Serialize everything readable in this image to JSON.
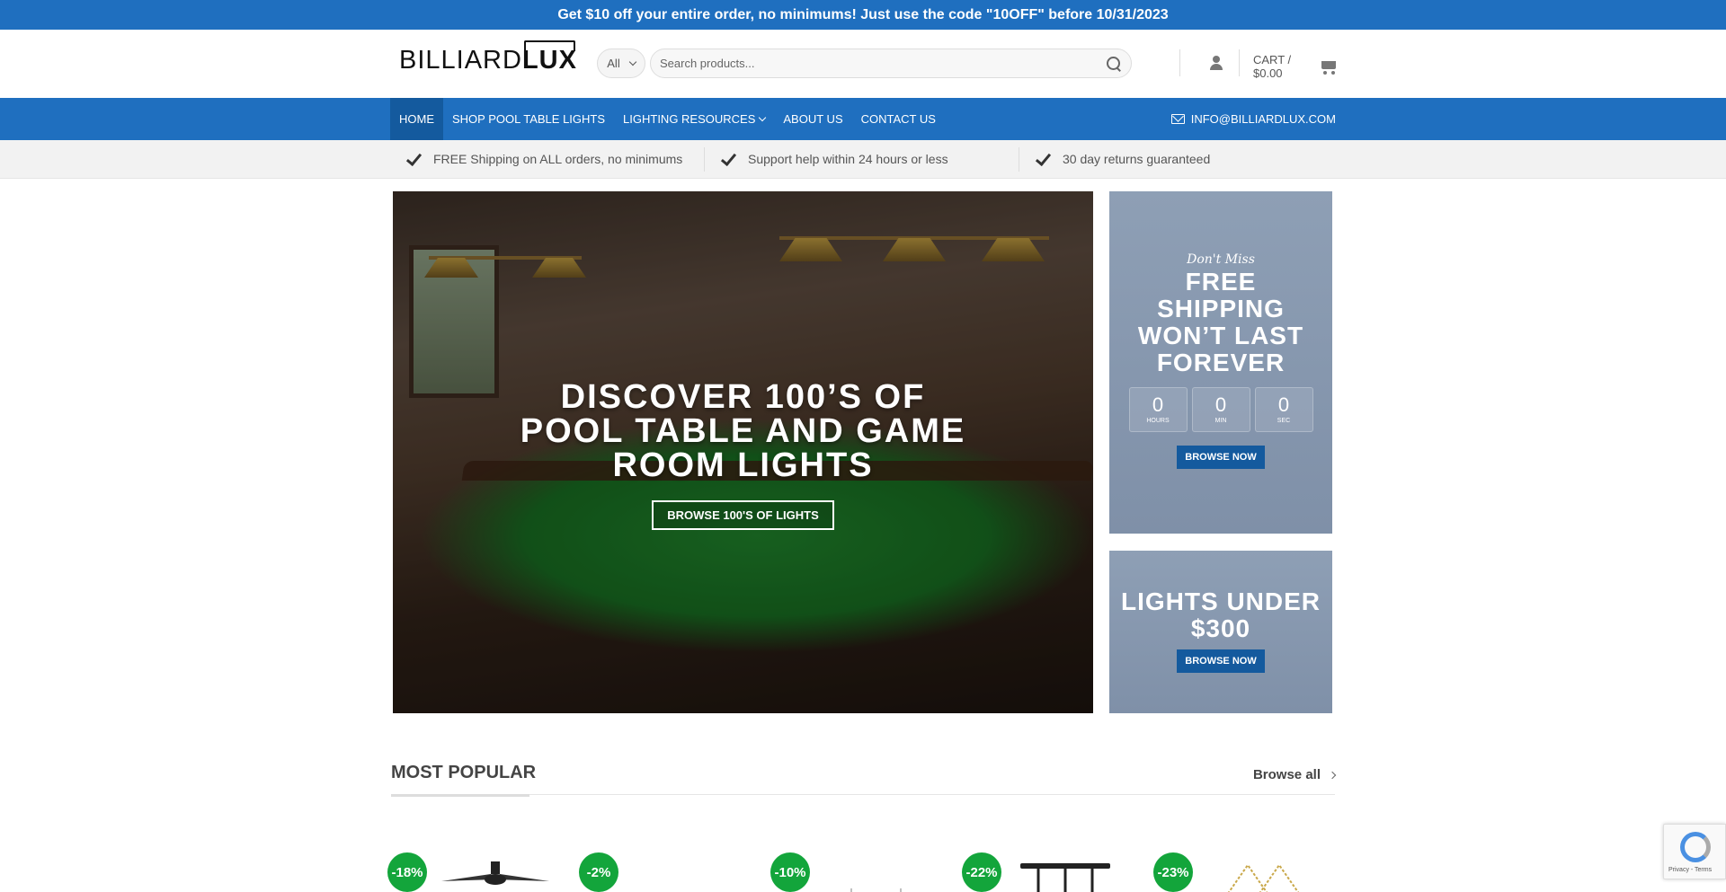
{
  "promo": {
    "text": "Get $10 off your entire order, no minimums! Just use the code \"10OFF\" before 10/31/2023"
  },
  "header": {
    "logo_part1": "BILLIARD",
    "logo_part2": "LUX",
    "category_selected": "All",
    "search_placeholder": "Search products...",
    "cart_label": "CART / $0.00"
  },
  "nav": {
    "items": [
      {
        "label": "HOME",
        "active": true
      },
      {
        "label": "SHOP POOL TABLE LIGHTS"
      },
      {
        "label": "LIGHTING RESOURCES",
        "dropdown": true
      },
      {
        "label": "ABOUT US"
      },
      {
        "label": "CONTACT US"
      }
    ],
    "email": "INFO@BILLIARDLUX.COM"
  },
  "usp": [
    "FREE Shipping on ALL orders, no minimums",
    "Support help within 24 hours or less",
    "30 day returns guaranteed"
  ],
  "hero": {
    "title": "DISCOVER 100’S OF POOL TABLE AND GAME ROOM LIGHTS",
    "button": "BROWSE 100'S OF LIGHTS"
  },
  "promo_box1": {
    "script": "Don't Miss",
    "title": "FREE SHIPPING WON’T LAST FOREVER",
    "countdown": [
      {
        "value": "0",
        "label": "HOURS"
      },
      {
        "value": "0",
        "label": "MIN"
      },
      {
        "value": "0",
        "label": "SEC"
      }
    ],
    "button": "BROWSE NOW"
  },
  "promo_box2": {
    "title": "LIGHTS UNDER $300",
    "button": "BROWSE NOW"
  },
  "section": {
    "title": "MOST POPULAR",
    "browse_all": "Browse all"
  },
  "products": [
    {
      "badge": "-18%"
    },
    {
      "badge": "-2%"
    },
    {
      "badge": "-10%"
    },
    {
      "badge": "-22%"
    },
    {
      "badge": "-23%"
    }
  ],
  "colors": {
    "brand_blue": "#1f6fbf",
    "nav_active": "#145a9e",
    "badge_green": "#13a53b",
    "promo_box": "#8e9fb5"
  },
  "recaptcha": {
    "text": "Privacy - Terms"
  }
}
